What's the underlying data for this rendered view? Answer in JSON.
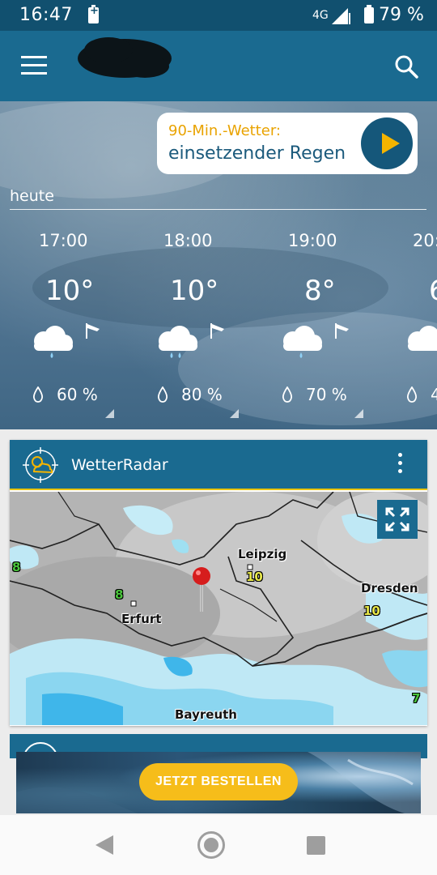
{
  "status_bar": {
    "time": "16:47",
    "network": "4G",
    "battery_percent": "79 %"
  },
  "nowcast": {
    "label": "90-Min.-Wetter:",
    "text": "einsetzender Regen"
  },
  "forecast": {
    "day_label": "heute",
    "hours": [
      {
        "time": "17:00",
        "temp": "10°",
        "precip": "60 %",
        "icon": "rain-cloud-icon"
      },
      {
        "time": "18:00",
        "temp": "10°",
        "precip": "80 %",
        "icon": "rain-cloud-icon"
      },
      {
        "time": "19:00",
        "temp": "8°",
        "precip": "70 %",
        "icon": "rain-cloud-icon"
      },
      {
        "time": "20:",
        "temp": "6",
        "precip": "4",
        "icon": "rain-cloud-icon"
      }
    ]
  },
  "radar": {
    "title": "WetterRadar",
    "cities": {
      "leipzig": "Leipzig",
      "dresden": "Dresden",
      "erfurt": "Erfurt",
      "bayreuth": "Bayreuth"
    },
    "values": {
      "west_edge": "8",
      "erfurt": "8",
      "leipzig": "10",
      "dresden": "10",
      "east": "7"
    }
  },
  "ad": {
    "button_label": "JETZT BESTELLEN"
  },
  "colors": {
    "appbar": "#1a6a90",
    "statusbar": "#11506f",
    "accent": "#f4b400",
    "nowcast_label": "#e9a300"
  }
}
